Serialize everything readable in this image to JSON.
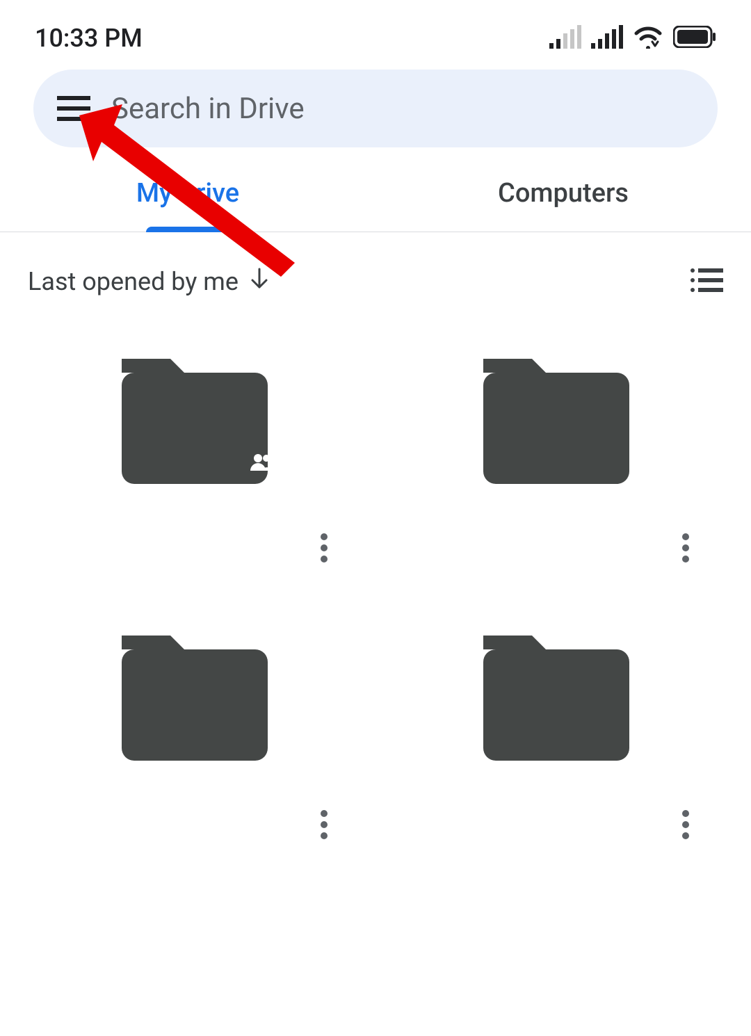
{
  "status_bar": {
    "time": "10:33 PM"
  },
  "search": {
    "placeholder": "Search in Drive"
  },
  "tabs": {
    "my_drive": "My Drive",
    "computers": "Computers",
    "active": "my_drive"
  },
  "sort": {
    "label": "Last opened by me"
  },
  "folders": [
    {
      "shared": true
    },
    {
      "shared": false
    },
    {
      "shared": false
    },
    {
      "shared": false
    }
  ],
  "annotation": {
    "arrow_color": "#e80000",
    "target": "hamburger-menu"
  }
}
